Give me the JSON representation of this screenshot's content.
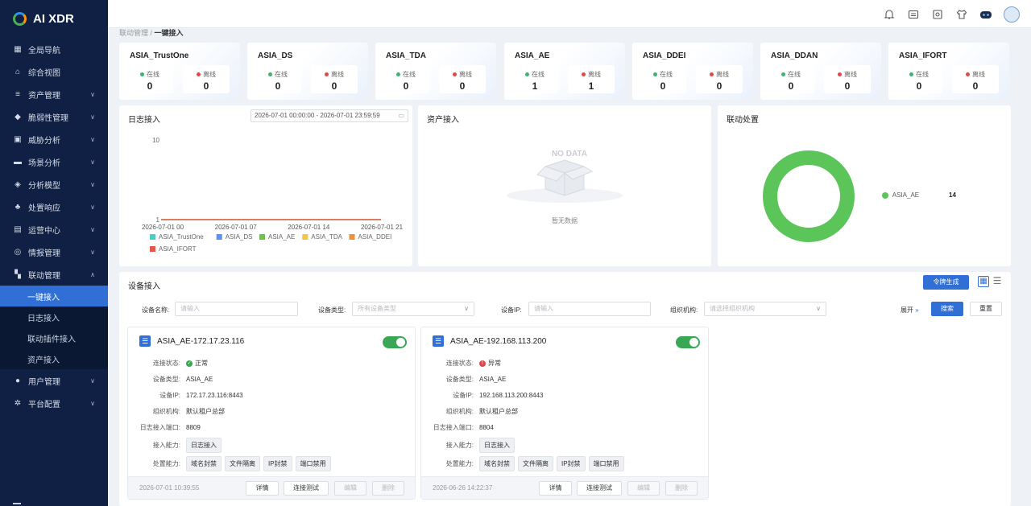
{
  "app": {
    "title": "AI XDR"
  },
  "sidebar": {
    "items": [
      {
        "label": "全局导航",
        "icon": "grid-icon"
      },
      {
        "label": "综合视图",
        "icon": "home-icon"
      },
      {
        "label": "资产管理",
        "icon": "database-icon"
      },
      {
        "label": "脆弱性管理",
        "icon": "shield-icon"
      },
      {
        "label": "威胁分析",
        "icon": "monitor-icon"
      },
      {
        "label": "场景分析",
        "icon": "book-icon"
      },
      {
        "label": "分析模型",
        "icon": "cube-icon"
      },
      {
        "label": "处置响应",
        "icon": "network-icon"
      },
      {
        "label": "运营中心",
        "icon": "clipboard-icon"
      },
      {
        "label": "情报管理",
        "icon": "radar-icon"
      },
      {
        "label": "联动管理",
        "icon": "link-icon"
      }
    ],
    "sub_items": [
      "一键接入",
      "日志接入",
      "联动插件接入",
      "资产接入"
    ],
    "bottom_items": [
      {
        "label": "用户管理",
        "icon": "user-icon"
      },
      {
        "label": "平台配置",
        "icon": "gear-icon"
      }
    ]
  },
  "breadcrumb": {
    "parent": "联动管理 /",
    "current": "一键接入"
  },
  "stats": [
    {
      "name": "ASIA_TrustOne",
      "online_label": "在线",
      "online": "0",
      "offline_label": "离线",
      "offline": "0"
    },
    {
      "name": "ASIA_DS",
      "online_label": "在线",
      "online": "0",
      "offline_label": "离线",
      "offline": "0"
    },
    {
      "name": "ASIA_TDA",
      "online_label": "在线",
      "online": "0",
      "offline_label": "离线",
      "offline": "0"
    },
    {
      "name": "ASIA_AE",
      "online_label": "在线",
      "online": "1",
      "offline_label": "离线",
      "offline": "1"
    },
    {
      "name": "ASIA_DDEI",
      "online_label": "在线",
      "online": "0",
      "offline_label": "离线",
      "offline": "0"
    },
    {
      "name": "ASIA_DDAN",
      "online_label": "在线",
      "online": "0",
      "offline_label": "离线",
      "offline": "0"
    },
    {
      "name": "ASIA_IFORT",
      "online_label": "在线",
      "online": "0",
      "offline_label": "离线",
      "offline": "0"
    }
  ],
  "log_panel": {
    "title": "日志接入",
    "date_range": "2026-07-01 00:00:00 - 2026-07-01 23:59:59"
  },
  "asset_panel": {
    "title": "资产接入",
    "nodata": "NO DATA",
    "empty_text": "暂无数据"
  },
  "linkage_panel": {
    "title": "联动处置",
    "legend_label": "ASIA_AE",
    "legend_value": "14"
  },
  "chart_data": {
    "type": "line",
    "x": [
      "2026-07-01 00",
      "2026-07-01 07",
      "2026-07-01 14",
      "2026-07-01 21"
    ],
    "y_ticks": [
      "10",
      "1"
    ],
    "series": [
      {
        "name": "ASIA_TrustOne",
        "color": "#4ecdc4"
      },
      {
        "name": "ASIA_DS",
        "color": "#5b8ff9"
      },
      {
        "name": "ASIA_AE",
        "color": "#6cc24a"
      },
      {
        "name": "ASIA_TDA",
        "color": "#f6c344"
      },
      {
        "name": "ASIA_DDEI",
        "color": "#f0913a"
      },
      {
        "name": "ASIA_IFORT",
        "color": "#e4574c"
      }
    ],
    "title": "",
    "xlabel": "",
    "ylabel": ""
  },
  "device": {
    "title": "设备接入",
    "generate_btn": "令牌生成",
    "filters": {
      "name_label": "设备名称:",
      "name_ph": "请输入",
      "type_label": "设备类型:",
      "type_ph": "所有设备类型",
      "ip_label": "设备IP:",
      "ip_ph": "请输入",
      "org_label": "组织机构:",
      "org_ph": "请选择组织机构"
    },
    "expand": "展开",
    "search_btn": "搜索",
    "reset_btn": "重置",
    "labels": {
      "status": "连接状态:",
      "type": "设备类型:",
      "ip": "设备IP:",
      "org": "组织机构:",
      "port": "日志接入端口:",
      "ability_in": "接入能力:",
      "ability_do": "处置能力:"
    },
    "cards": [
      {
        "title": "ASIA_AE-172.17.23.116",
        "status": "正常",
        "type": "ASIA_AE",
        "ip": "172.17.23.116:8443",
        "org": "默认租户总部",
        "port": "8809",
        "ability_in": [
          "日志接入"
        ],
        "ability_do": [
          "域名封禁",
          "文件隔离",
          "IP封禁",
          "端口禁用"
        ],
        "time": "2026-07-01 10:39:55"
      },
      {
        "title": "ASIA_AE-192.168.113.200",
        "status": "异常",
        "type": "ASIA_AE",
        "ip": "192.168.113.200:8443",
        "org": "默认租户总部",
        "port": "8804",
        "ability_in": [
          "日志接入"
        ],
        "ability_do": [
          "域名封禁",
          "文件隔离",
          "IP封禁",
          "端口禁用"
        ],
        "time": "2026-06-26 14:22:37"
      }
    ],
    "buttons": {
      "detail": "详情",
      "test": "连接测试",
      "edit": "编辑",
      "delete": "删除"
    }
  }
}
